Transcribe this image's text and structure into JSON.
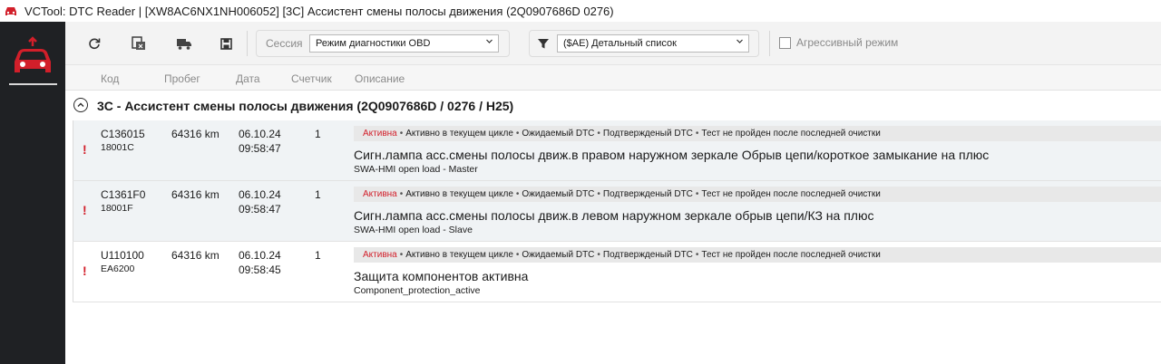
{
  "window": {
    "title": "VCTool: DTC Reader | [XW8AC6NX1NH006052] [3C] Ассистент смены полосы движения (2Q0907686D 0276)"
  },
  "sidebar": {
    "logo_icon": "car-diagnostic-icon"
  },
  "toolbar": {
    "buttons": [
      {
        "name": "refresh",
        "icon": "refresh-icon"
      },
      {
        "name": "clear-dtc",
        "icon": "clear-dtc-icon"
      },
      {
        "name": "freeze-frame",
        "icon": "truck-icon"
      },
      {
        "name": "save",
        "icon": "save-icon"
      }
    ],
    "session_label": "Сессия",
    "session_value": "Режим диагностики OBD",
    "filter_value": "($AE) Детальный список",
    "aggressive_label": "Агрессивный режим",
    "aggressive_checked": false
  },
  "columns": {
    "code": "Код",
    "mileage": "Пробег",
    "date": "Дата",
    "counter": "Счетчик",
    "description": "Описание"
  },
  "group": {
    "title": "3C - Ассистент смены полосы движения (2Q0907686D / 0276 / H25)"
  },
  "dtcs": [
    {
      "warning": "!",
      "code": "C136015",
      "code2": "18001C",
      "mileage": "64316 km",
      "date": "06.10.24",
      "time": "09:58:47",
      "count": "1",
      "status_active": "Активна",
      "status_flags": [
        "Активно в текущем цикле",
        "Ожидаемый DTC",
        "Подтвержденый DTC",
        "Тест не пройден после последней очистки"
      ],
      "description": "Сигн.лампа асс.смены полосы движ.в правом наружном зеркале Обрыв цепи/короткое замыкание на плюс",
      "sub": "SWA-HMI open load - Master"
    },
    {
      "warning": "!",
      "code": "C1361F0",
      "code2": "18001F",
      "mileage": "64316 km",
      "date": "06.10.24",
      "time": "09:58:47",
      "count": "1",
      "status_active": "Активна",
      "status_flags": [
        "Активно в текущем цикле",
        "Ожидаемый DTC",
        "Подтвержденый DTC",
        "Тест не пройден после последней очистки"
      ],
      "description": "Сигн.лампа асс.смены полосы движ.в левом наружном зеркале обрыв цепи/КЗ на плюс",
      "sub": "SWA-HMI open load - Slave"
    },
    {
      "warning": "!",
      "code": "U110100",
      "code2": "EA6200",
      "mileage": "64316 km",
      "date": "06.10.24",
      "time": "09:58:45",
      "count": "1",
      "status_active": "Активна",
      "status_flags": [
        "Активно в текущем цикле",
        "Ожидаемый DTC",
        "Подтвержденый DTC",
        "Тест не пройден после последней очистки"
      ],
      "description": "Защита компонентов активна",
      "sub": "Component_protection_active"
    }
  ],
  "colors": {
    "accent_red": "#d21f2a",
    "sidebar": "#1f2124",
    "row_alt": "#f0f3f5",
    "status_bar": "#e8e8e8"
  }
}
